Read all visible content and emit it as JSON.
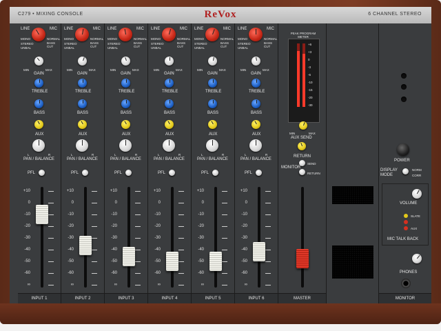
{
  "header": {
    "model": "C279  •  MIXING  CONSOLE",
    "brand": "ReVox",
    "desc": "6  CHANNEL  STEREO"
  },
  "channel_labels": {
    "line": "LINE",
    "mic": "MIC",
    "mono": "MONO",
    "normal": "NORMAL",
    "stereo": "STEREO",
    "bass_cut": "BASS CUT",
    "unbal": "UNBAL",
    "min": "MIN",
    "max": "MAX",
    "gain": "GAIN",
    "treble": "TREBLE",
    "bass": "BASS",
    "aux": "AUX",
    "pan_balance": "PAN / BALANCE",
    "pfl": "PFL",
    "l": "L",
    "r": "R"
  },
  "fader_scale": [
    "+10",
    "0",
    "-10",
    "-20",
    "-30",
    "-40",
    "-50",
    "-60",
    "∞"
  ],
  "channels": [
    {
      "name": "INPUT 1",
      "fader_level": 0.78
    },
    {
      "name": "INPUT 2",
      "fader_level": 0.4
    },
    {
      "name": "INPUT 3",
      "fader_level": 0.26
    },
    {
      "name": "INPUT 4",
      "fader_level": 0.2
    },
    {
      "name": "INPUT 5",
      "fader_level": 0.2
    },
    {
      "name": "INPUT 6",
      "fader_level": 0.32
    }
  ],
  "master": {
    "name": "MASTER",
    "meter_title": "PEAK PROGRAM METER",
    "meter_scale": [
      "+6",
      "+3",
      "0",
      "-3",
      "-6",
      "-10",
      "-15",
      "-20",
      "-30"
    ],
    "meter_left": 0.88,
    "meter_right": 0.84,
    "aux_send": "AUX  SEND",
    "return": "RETURN",
    "monitor": "MONITOR",
    "send": "SEND",
    "return_small": "RETURN",
    "fader_level": 0.24
  },
  "right": {
    "power": "POWER",
    "display_mode": "DISPLAY MODE",
    "norm": "NORM",
    "corr": "CORR",
    "volume": "VOLUME",
    "slate": "SLATE",
    "aux": "AUX",
    "mic_talk_back": "MIC  TALK  BACK",
    "phones": "PHONES",
    "monitor": "MONITOR"
  }
}
